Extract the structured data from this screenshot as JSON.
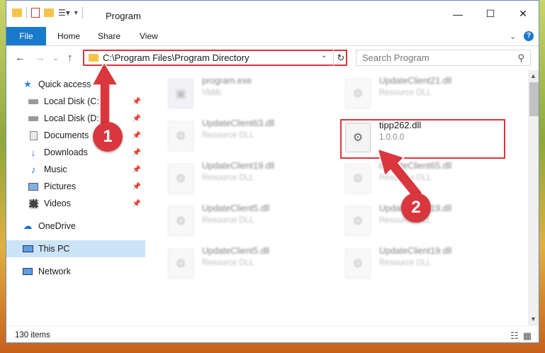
{
  "window": {
    "title": "Program",
    "controls": {
      "minimize": "—",
      "maximize": "☐",
      "close": "✕"
    }
  },
  "ribbon": {
    "tabs": [
      "File",
      "Home",
      "Share",
      "View"
    ],
    "help": "?"
  },
  "address": {
    "path": "C:\\Program Files\\Program Directory",
    "search_placeholder": "Search Program"
  },
  "nav": {
    "quick_access": "Quick access",
    "items": [
      {
        "label": "Local Disk (C:)",
        "icon": "drive-icon"
      },
      {
        "label": "Local Disk (D:)",
        "icon": "drive-icon"
      },
      {
        "label": "Documents",
        "icon": "documents-icon"
      },
      {
        "label": "Downloads",
        "icon": "downloads-icon"
      },
      {
        "label": "Music",
        "icon": "music-icon"
      },
      {
        "label": "Pictures",
        "icon": "pictures-icon"
      },
      {
        "label": "Videos",
        "icon": "videos-icon"
      }
    ],
    "onedrive": "OneDrive",
    "this_pc": "This PC",
    "network": "Network"
  },
  "files": {
    "left": [
      {
        "name": "program.exe",
        "type": "Vbbb"
      },
      {
        "name": "UpdateClient63.dll",
        "type": "Resource DLL"
      },
      {
        "name": "UpdateClient19.dll",
        "type": "Resource DLL"
      },
      {
        "name": "UpdateClient5.dll",
        "type": "Resource DLL"
      },
      {
        "name": "UpdateClient5.dll",
        "type": "Resource DLL"
      }
    ],
    "right": [
      {
        "name": "UpdateClient21.dll",
        "type": "Resource DLL"
      },
      {
        "name": "tipp262.dll",
        "type": "1.0.0.0"
      },
      {
        "name": "UpdateClient65.dll",
        "type": "Resource DLL"
      },
      {
        "name": "UpdateClient19.dll",
        "type": "Resource DLL"
      },
      {
        "name": "UpdateClient19.dll",
        "type": "Resource DLL"
      }
    ]
  },
  "status": {
    "count": "130 items"
  },
  "annotations": {
    "step1": "1",
    "step2": "2"
  },
  "colors": {
    "accent": "#1979ca",
    "highlight": "#d9363e"
  }
}
